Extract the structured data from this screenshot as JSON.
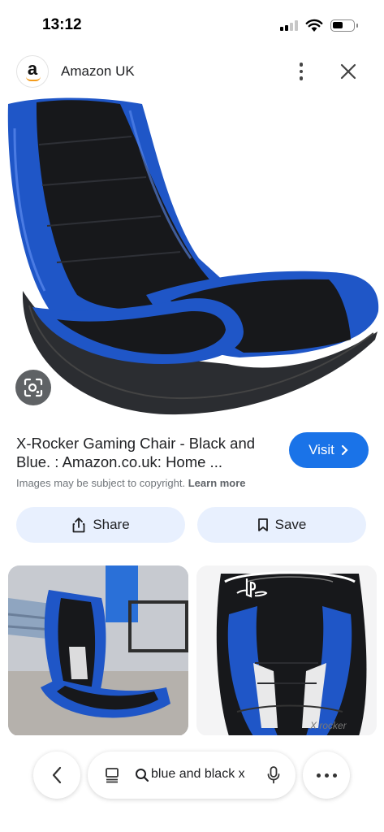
{
  "status_bar": {
    "time": "13:12"
  },
  "source": {
    "name": "Amazon UK",
    "logo_letter": "a"
  },
  "result": {
    "title": "X-Rocker Gaming Chair - Black and Blue. : Amazon.co.uk: Home ...",
    "visit_label": "Visit",
    "copyright_text": "Images may be subject to copyright.",
    "learn_more": "Learn more"
  },
  "actions": {
    "share_label": "Share",
    "save_label": "Save"
  },
  "related": [
    {
      "name": "related-image-1"
    },
    {
      "name": "related-image-2",
      "logo_text": "X rocker"
    }
  ],
  "search": {
    "query": "blue and black x"
  },
  "colors": {
    "accent": "#1a73e8",
    "action_bg": "#e8f0fe",
    "chair_blue": "#1f56c7"
  }
}
